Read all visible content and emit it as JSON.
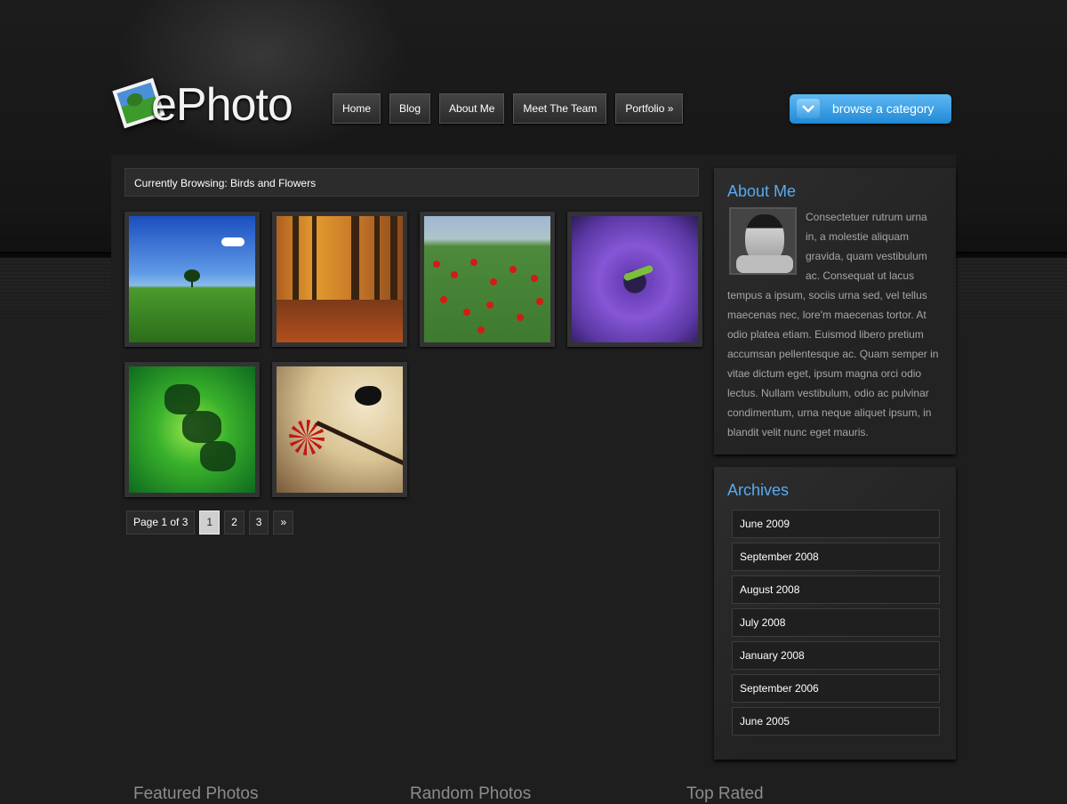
{
  "logo": {
    "text": "ePhoto"
  },
  "nav": {
    "items": [
      "Home",
      "Blog",
      "About Me",
      "Meet The Team",
      "Portfolio »"
    ]
  },
  "browse_button": {
    "label": "browse a category"
  },
  "browsing": {
    "text": "Currently Browsing: Birds and Flowers"
  },
  "gallery": {
    "photos": [
      "field-photo",
      "forest-photo",
      "poppies-photo",
      "anemone-photo",
      "frog-photo",
      "hummingbird-photo"
    ]
  },
  "pagination": {
    "info": "Page 1 of 3",
    "pages": [
      "1",
      "2",
      "3"
    ],
    "current": "1",
    "next": "»"
  },
  "about": {
    "title": "About Me",
    "text": "Consectetuer rutrum urna in, a molestie aliquam gravida, quam vestibulum ac. Consequat ut lacus tempus a ipsum, sociis urna sed, vel tellus maecenas nec, lore'm maecenas tortor. At odio platea etiam. Euismod libero pretium accumsan pellentesque ac. Quam semper in vitae dictum eget, ipsum magna orci odio lectus. Nullam vestibulum, odio ac pulvinar condimentum, urna neque aliquet ipsum, in blandit velit nunc eget mauris."
  },
  "archives": {
    "title": "Archives",
    "items": [
      "June 2009",
      "September 2008",
      "August 2008",
      "July 2008",
      "January 2008",
      "September 2006",
      "June 2005"
    ]
  },
  "footer": {
    "headings": [
      "Featured Photos",
      "Random Photos",
      "Top Rated"
    ]
  },
  "colors": {
    "accent": "#5aaaf0",
    "browse_button": "#2189d5",
    "background": "#1e1e1e"
  }
}
